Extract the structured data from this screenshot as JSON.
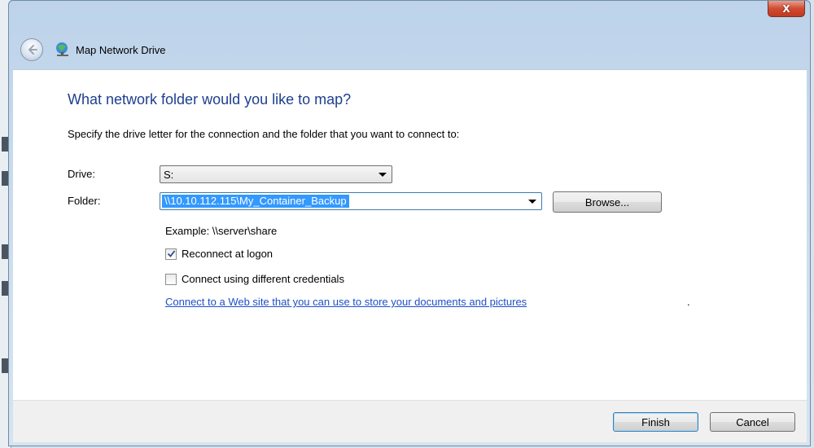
{
  "window": {
    "close_symbol": "X",
    "header_title": "Map Network Drive",
    "icons": {
      "back": "back-arrow-icon",
      "network": "network-drive-icon",
      "close": "close-icon"
    }
  },
  "content": {
    "heading": "What network folder would you like to map?",
    "instruction": "Specify the drive letter for the connection and the folder that you want to connect to:",
    "drive_label": "Drive:",
    "drive_value": "S:",
    "folder_label": "Folder:",
    "folder_value": "\\\\10.10.112.115\\My_Container_Backup",
    "browse_label": "Browse...",
    "example_text": "Example: \\\\server\\share",
    "reconnect_label": "Reconnect at logon",
    "reconnect_checked": true,
    "credentials_label": "Connect using different credentials",
    "credentials_checked": false,
    "web_link": "Connect to a Web site that you can use to store your documents and pictures",
    "web_link_suffix": "."
  },
  "footer": {
    "finish_label": "Finish",
    "cancel_label": "Cancel"
  },
  "colors": {
    "heading": "#1e3f8f",
    "link": "#1e50c8",
    "selection": "#3399ff",
    "close_button": "#c03a22"
  }
}
